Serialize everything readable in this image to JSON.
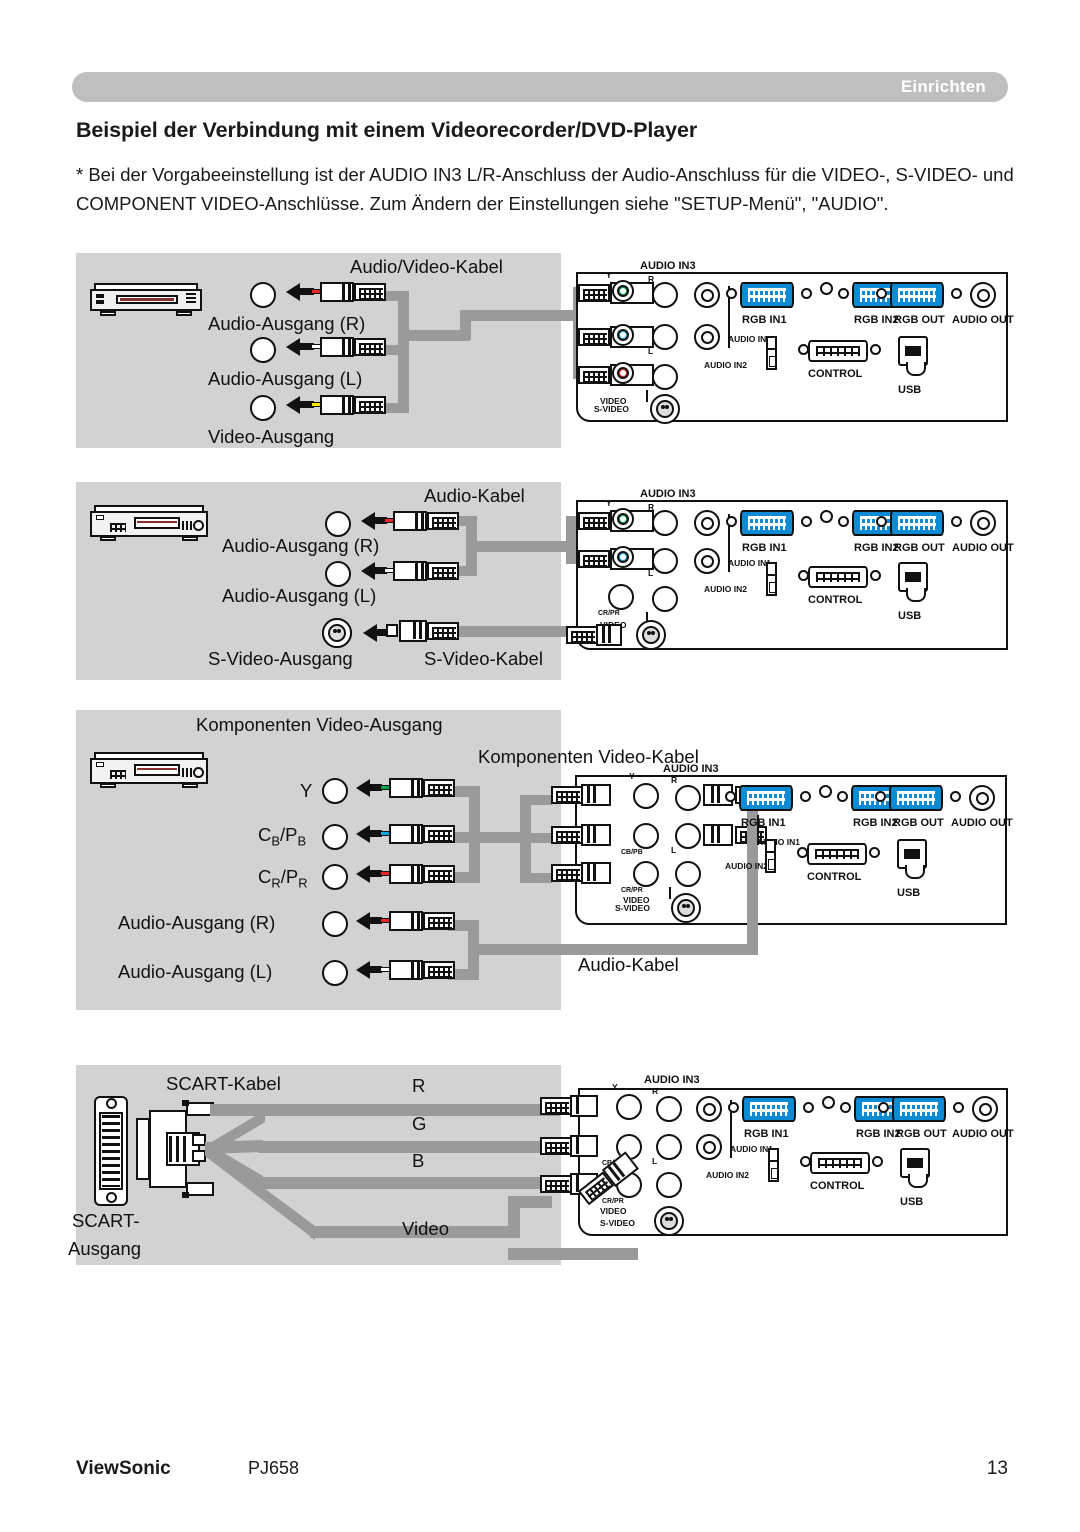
{
  "header": {
    "chapter_label": "Einrichten"
  },
  "title": "Beispiel der Verbindung mit einem Videorecorder/DVD-Player",
  "note": "* Bei der Vorgabeeinstellung ist der AUDIO IN3 L/R-Anschluss der Audio-Anschluss für die VIDEO-, S-VIDEO- und COMPONENT VIDEO-Anschlüsse. Zum Ändern der Einstellungen siehe \"SETUP-Menü\", \"AUDIO\".",
  "footer": {
    "brand": "ViewSonic",
    "model": "PJ658",
    "page_number": "13"
  },
  "panel_labels": {
    "audio_in3": "AUDIO IN3",
    "audio_in1": "AUDIO IN1",
    "audio_in2": "AUDIO IN2",
    "rgb_in1": "RGB IN1",
    "rgb_in2": "RGB IN2",
    "rgb_out": "RGB OUT",
    "audio_out": "AUDIO OUT",
    "control": "CONTROL",
    "usb": "USB",
    "video": "VIDEO",
    "s_video": "S-VIDEO",
    "y": "Y",
    "r": "R",
    "l": "L",
    "cb_pb": "CB/PB",
    "cr_pr": "CR/PR"
  },
  "figures": [
    {
      "id": "fig-av-cable",
      "device": "vcr",
      "cable_label": "Audio/Video-Kabel",
      "ports": [
        {
          "label": "Audio-Ausgang (R)",
          "color": "red"
        },
        {
          "label": "Audio-Ausgang (L)",
          "color": "white"
        },
        {
          "label": "Video-Ausgang",
          "color": "yellow"
        }
      ]
    },
    {
      "id": "fig-audio-svideo",
      "device": "dvd",
      "cable_label": "Audio-Kabel",
      "svideo_cable_label": "S-Video-Kabel",
      "ports": [
        {
          "label": "Audio-Ausgang (R)",
          "color": "red"
        },
        {
          "label": "Audio-Ausgang (L)",
          "color": "white"
        },
        {
          "label": "S-Video-Ausgang",
          "color": "svideo"
        }
      ]
    },
    {
      "id": "fig-component",
      "device": "dvd",
      "heading": "Komponenten Video-Ausgang",
      "cable_label": "Komponenten Video-Kabel",
      "audio_cable_label": "Audio-Kabel",
      "ports": [
        {
          "label": "Y",
          "color": "green"
        },
        {
          "label": "CB/PB",
          "color": "blue"
        },
        {
          "label": "CR/PR",
          "color": "red"
        },
        {
          "label": "Audio-Ausgang (R)",
          "color": "red"
        },
        {
          "label": "Audio-Ausgang (L)",
          "color": "white"
        }
      ]
    },
    {
      "id": "fig-scart",
      "device": "scart",
      "cable_label": "SCART-Kabel",
      "output_label_line1": "SCART-",
      "output_label_line2": "Ausgang",
      "leads": [
        "R",
        "G",
        "B",
        "Video"
      ]
    }
  ],
  "colors": {
    "header_bar": "#bfbfbf",
    "figure_background": "#d2d2d2",
    "cable": "#9a9a9a",
    "vga_blue": "#0c8bd4",
    "jack_red": "#e8262a",
    "jack_yellow": "#f5e400",
    "jack_green": "#00a64f",
    "jack_blue": "#0aa3e0"
  }
}
